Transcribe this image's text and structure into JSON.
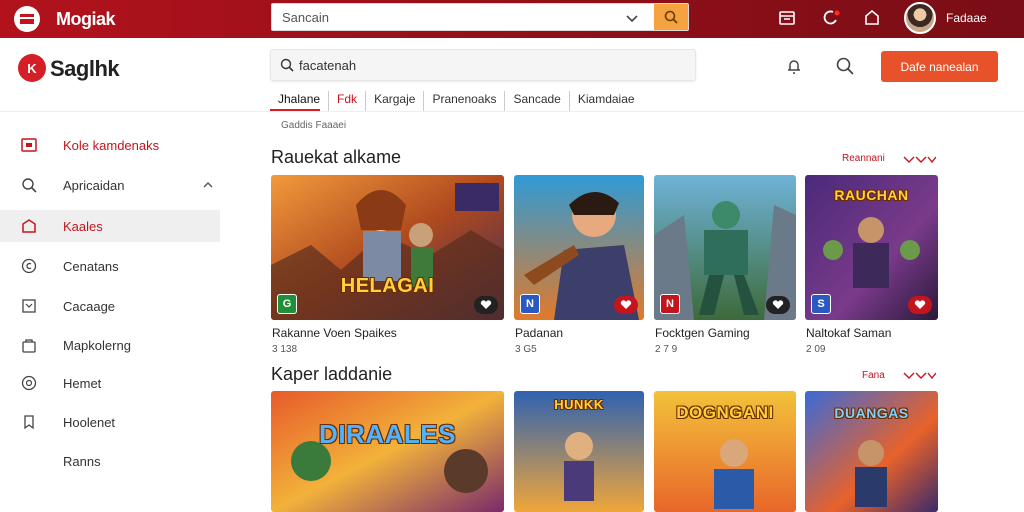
{
  "topbar": {
    "brand": "Mogiak",
    "search_value": "Sancain",
    "user_name": "Fadaae"
  },
  "header": {
    "brand": "Saglhk",
    "logo_text": "K",
    "search_value": "facatenah",
    "cta_label": "Dafe nanealan",
    "tabs": [
      {
        "label": "Jhalane"
      },
      {
        "label": "Fdk"
      },
      {
        "label": "Kargaje"
      },
      {
        "label": "Pranenoaks"
      },
      {
        "label": "Sancade"
      },
      {
        "label": "Kiamdaiae"
      }
    ],
    "sub_label": "Gaddis Faaaei"
  },
  "sidebar": {
    "items": [
      {
        "label": "Kole kamdenaks",
        "icon": "tv-icon"
      },
      {
        "label": "Apricaidan",
        "icon": "search-icon"
      },
      {
        "label": "Kaales",
        "icon": "home-icon"
      },
      {
        "label": "Cenatans",
        "icon": "circle-c-icon"
      },
      {
        "label": "Cacaage",
        "icon": "box-icon"
      },
      {
        "label": "Mapkolerng",
        "icon": "bag-icon"
      },
      {
        "label": "Hemet",
        "icon": "globe-icon"
      },
      {
        "label": "Hoolenet",
        "icon": "bookmark-icon"
      },
      {
        "label": "Ranns",
        "icon": ""
      }
    ]
  },
  "section1": {
    "title": "Rauekat alkame",
    "more_label": "Reannani",
    "cards": [
      {
        "name": "Rakanne Voen Spaikes",
        "meta": "3 138",
        "art_title": "HELAGAI",
        "badge": "G"
      },
      {
        "name": "Padanan",
        "meta": "3 G5",
        "art_title": "",
        "badge": "N"
      },
      {
        "name": "Focktgen Gaming",
        "meta": "2 7 9",
        "art_title": "",
        "badge": "N"
      },
      {
        "name": "Naltokaf Saman",
        "meta": "2 09",
        "art_title": "RAUCHAN",
        "badge": "S"
      }
    ]
  },
  "section2": {
    "title": "Kaper laddanie",
    "more_label": "Fana",
    "cards": [
      {
        "art_title": "DIRAALES"
      },
      {
        "art_title": "HUNKK"
      },
      {
        "art_title": "DOGNGANI"
      },
      {
        "art_title": "DUANGAS"
      }
    ]
  },
  "colors": {
    "topbar": "#b3121c",
    "accent": "#d41f26",
    "cta": "#e8522a",
    "search_button": "#f4a340"
  }
}
